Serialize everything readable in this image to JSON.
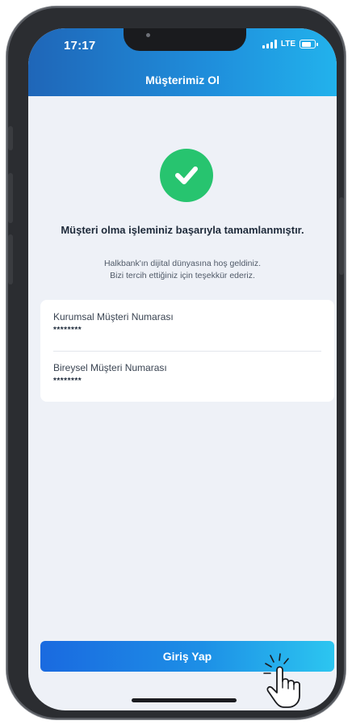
{
  "status_bar": {
    "time": "17:17",
    "network": "LTE"
  },
  "header": {
    "title": "Müşterimiz Ol"
  },
  "success": {
    "title": "Müşteri olma işleminiz başarıyla tamamlanmıştır.",
    "line1": "Halkbank'ın dijital dünyasına hoş geldiniz.",
    "line2": "Bizi tercih ettiğiniz için teşekkür ederiz."
  },
  "fields": [
    {
      "label": "Kurumsal Müşteri Numarası",
      "value": "********"
    },
    {
      "label": "Bireysel Müşteri Numarası",
      "value": "********"
    }
  ],
  "actions": {
    "login_label": "Giriş Yap"
  },
  "colors": {
    "header_start": "#1f66b8",
    "header_end": "#22b2ec",
    "success_green": "#27c46f",
    "background": "#eef1f7",
    "button_start": "#1a6ae0",
    "button_end": "#2cc6f0"
  },
  "icons": [
    "check-icon",
    "signal-icon",
    "battery-icon",
    "hand-pointer-icon"
  ]
}
